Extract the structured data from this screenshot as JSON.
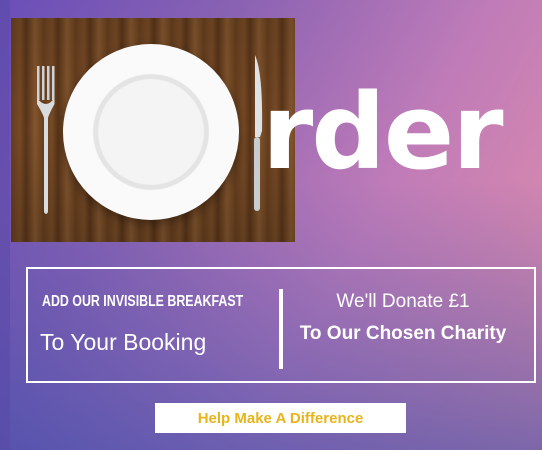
{
  "headline": {
    "word": "rder"
  },
  "offer": {
    "left_line1": "ADD OUR INVISIBLE BREAKFAST",
    "left_line2": "To Your Booking",
    "right_line1": "We'll Donate £1",
    "right_line2": "To Our Chosen Charity"
  },
  "cta": {
    "label": "Help Make A Difference"
  },
  "colors": {
    "cta_text": "#e8b41a",
    "gradient_start": "#6a4fb8",
    "gradient_end": "#e58fa8"
  }
}
